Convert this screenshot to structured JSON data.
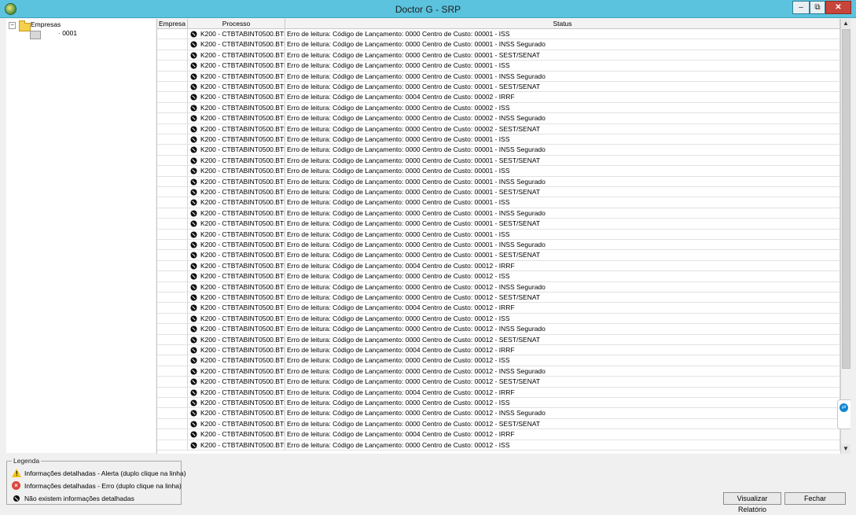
{
  "window": {
    "title": "Doctor G - SRP",
    "min_label": "–",
    "max_label": "⧉",
    "close_label": "✕"
  },
  "tree": {
    "root_label": "Empresas",
    "root_expander": "−",
    "child_label": "· 0001"
  },
  "grid": {
    "headers": {
      "empresa": "Empresa",
      "processo": "Processo",
      "status": "Status"
    },
    "rows": [
      {
        "empresa": "",
        "processo": "K200 - CTBTABINT0500.BTR",
        "status": "Erro de leitura: Código de Lançamento: 0000 Centro de Custo: 00001 - ISS"
      },
      {
        "empresa": "",
        "processo": "K200 - CTBTABINT0500.BTR",
        "status": "Erro de leitura: Código de Lançamento: 0000 Centro de Custo: 00001 - INSS Segurado"
      },
      {
        "empresa": "",
        "processo": "K200 - CTBTABINT0500.BTR",
        "status": "Erro de leitura: Código de Lançamento: 0000 Centro de Custo: 00001 - SEST/SENAT"
      },
      {
        "empresa": "",
        "processo": "K200 - CTBTABINT0500.BTR",
        "status": "Erro de leitura: Código de Lançamento: 0000 Centro de Custo: 00001 - ISS"
      },
      {
        "empresa": "",
        "processo": "K200 - CTBTABINT0500.BTR",
        "status": "Erro de leitura: Código de Lançamento: 0000 Centro de Custo: 00001 - INSS Segurado"
      },
      {
        "empresa": "",
        "processo": "K200 - CTBTABINT0500.BTR",
        "status": "Erro de leitura: Código de Lançamento: 0000 Centro de Custo: 00001 - SEST/SENAT"
      },
      {
        "empresa": "",
        "processo": "K200 - CTBTABINT0500.BTR",
        "status": "Erro de leitura: Código de Lançamento: 0004 Centro de Custo: 00002 - IRRF"
      },
      {
        "empresa": "",
        "processo": "K200 - CTBTABINT0500.BTR",
        "status": "Erro de leitura: Código de Lançamento: 0000 Centro de Custo: 00002 - ISS"
      },
      {
        "empresa": "",
        "processo": "K200 - CTBTABINT0500.BTR",
        "status": "Erro de leitura: Código de Lançamento: 0000 Centro de Custo: 00002 - INSS Segurado"
      },
      {
        "empresa": "",
        "processo": "K200 - CTBTABINT0500.BTR",
        "status": "Erro de leitura: Código de Lançamento: 0000 Centro de Custo: 00002 - SEST/SENAT"
      },
      {
        "empresa": "",
        "processo": "K200 - CTBTABINT0500.BTR",
        "status": "Erro de leitura: Código de Lançamento: 0000 Centro de Custo: 00001 - ISS"
      },
      {
        "empresa": "",
        "processo": "K200 - CTBTABINT0500.BTR",
        "status": "Erro de leitura: Código de Lançamento: 0000 Centro de Custo: 00001 - INSS Segurado"
      },
      {
        "empresa": "",
        "processo": "K200 - CTBTABINT0500.BTR",
        "status": "Erro de leitura: Código de Lançamento: 0000 Centro de Custo: 00001 - SEST/SENAT"
      },
      {
        "empresa": "",
        "processo": "K200 - CTBTABINT0500.BTR",
        "status": "Erro de leitura: Código de Lançamento: 0000 Centro de Custo: 00001 - ISS"
      },
      {
        "empresa": "",
        "processo": "K200 - CTBTABINT0500.BTR",
        "status": "Erro de leitura: Código de Lançamento: 0000 Centro de Custo: 00001 - INSS Segurado"
      },
      {
        "empresa": "",
        "processo": "K200 - CTBTABINT0500.BTR",
        "status": "Erro de leitura: Código de Lançamento: 0000 Centro de Custo: 00001 - SEST/SENAT"
      },
      {
        "empresa": "",
        "processo": "K200 - CTBTABINT0500.BTR",
        "status": "Erro de leitura: Código de Lançamento: 0000 Centro de Custo: 00001 - ISS"
      },
      {
        "empresa": "",
        "processo": "K200 - CTBTABINT0500.BTR",
        "status": "Erro de leitura: Código de Lançamento: 0000 Centro de Custo: 00001 - INSS Segurado"
      },
      {
        "empresa": "",
        "processo": "K200 - CTBTABINT0500.BTR",
        "status": "Erro de leitura: Código de Lançamento: 0000 Centro de Custo: 00001 - SEST/SENAT"
      },
      {
        "empresa": "",
        "processo": "K200 - CTBTABINT0500.BTR",
        "status": "Erro de leitura: Código de Lançamento: 0000 Centro de Custo: 00001 - ISS"
      },
      {
        "empresa": "",
        "processo": "K200 - CTBTABINT0500.BTR",
        "status": "Erro de leitura: Código de Lançamento: 0000 Centro de Custo: 00001 - INSS Segurado"
      },
      {
        "empresa": "",
        "processo": "K200 - CTBTABINT0500.BTR",
        "status": "Erro de leitura: Código de Lançamento: 0000 Centro de Custo: 00001 - SEST/SENAT"
      },
      {
        "empresa": "",
        "processo": "K200 - CTBTABINT0500.BTR",
        "status": "Erro de leitura: Código de Lançamento: 0004 Centro de Custo: 00012 - IRRF"
      },
      {
        "empresa": "",
        "processo": "K200 - CTBTABINT0500.BTR",
        "status": "Erro de leitura: Código de Lançamento: 0000 Centro de Custo: 00012 - ISS"
      },
      {
        "empresa": "",
        "processo": "K200 - CTBTABINT0500.BTR",
        "status": "Erro de leitura: Código de Lançamento: 0000 Centro de Custo: 00012 - INSS Segurado"
      },
      {
        "empresa": "",
        "processo": "K200 - CTBTABINT0500.BTR",
        "status": "Erro de leitura: Código de Lançamento: 0000 Centro de Custo: 00012 - SEST/SENAT"
      },
      {
        "empresa": "",
        "processo": "K200 - CTBTABINT0500.BTR",
        "status": "Erro de leitura: Código de Lançamento: 0004 Centro de Custo: 00012 - IRRF"
      },
      {
        "empresa": "",
        "processo": "K200 - CTBTABINT0500.BTR",
        "status": "Erro de leitura: Código de Lançamento: 0000 Centro de Custo: 00012 - ISS"
      },
      {
        "empresa": "",
        "processo": "K200 - CTBTABINT0500.BTR",
        "status": "Erro de leitura: Código de Lançamento: 0000 Centro de Custo: 00012 - INSS Segurado"
      },
      {
        "empresa": "",
        "processo": "K200 - CTBTABINT0500.BTR",
        "status": "Erro de leitura: Código de Lançamento: 0000 Centro de Custo: 00012 - SEST/SENAT"
      },
      {
        "empresa": "",
        "processo": "K200 - CTBTABINT0500.BTR",
        "status": "Erro de leitura: Código de Lançamento: 0004 Centro de Custo: 00012 - IRRF"
      },
      {
        "empresa": "",
        "processo": "K200 - CTBTABINT0500.BTR",
        "status": "Erro de leitura: Código de Lançamento: 0000 Centro de Custo: 00012 - ISS"
      },
      {
        "empresa": "",
        "processo": "K200 - CTBTABINT0500.BTR",
        "status": "Erro de leitura: Código de Lançamento: 0000 Centro de Custo: 00012 - INSS Segurado"
      },
      {
        "empresa": "",
        "processo": "K200 - CTBTABINT0500.BTR",
        "status": "Erro de leitura: Código de Lançamento: 0000 Centro de Custo: 00012 - SEST/SENAT"
      },
      {
        "empresa": "",
        "processo": "K200 - CTBTABINT0500.BTR",
        "status": "Erro de leitura: Código de Lançamento: 0004 Centro de Custo: 00012 - IRRF"
      },
      {
        "empresa": "",
        "processo": "K200 - CTBTABINT0500.BTR",
        "status": "Erro de leitura: Código de Lançamento: 0000 Centro de Custo: 00012 - ISS"
      },
      {
        "empresa": "",
        "processo": "K200 - CTBTABINT0500.BTR",
        "status": "Erro de leitura: Código de Lançamento: 0000 Centro de Custo: 00012 - INSS Segurado"
      },
      {
        "empresa": "",
        "processo": "K200 - CTBTABINT0500.BTR",
        "status": "Erro de leitura: Código de Lançamento: 0000 Centro de Custo: 00012 - SEST/SENAT"
      },
      {
        "empresa": "",
        "processo": "K200 - CTBTABINT0500.BTR",
        "status": "Erro de leitura: Código de Lançamento: 0004 Centro de Custo: 00012 - IRRF"
      },
      {
        "empresa": "",
        "processo": "K200 - CTBTABINT0500.BTR",
        "status": "Erro de leitura: Código de Lançamento: 0000 Centro de Custo: 00012 - ISS"
      }
    ]
  },
  "legend": {
    "title": "Legenda",
    "alert": "Informações detalhadas - Alerta (duplo clique na linha)",
    "error": "Informações detalhadas - Erro   (duplo clique na linha)",
    "none": "Não existem informações detalhadas"
  },
  "buttons": {
    "report": "Visualizar Relatório",
    "close": "Fechar"
  },
  "scrollbar": {
    "up": "▲",
    "down": "▼"
  },
  "side_widget": {
    "icon": "teamviewer-icon"
  }
}
